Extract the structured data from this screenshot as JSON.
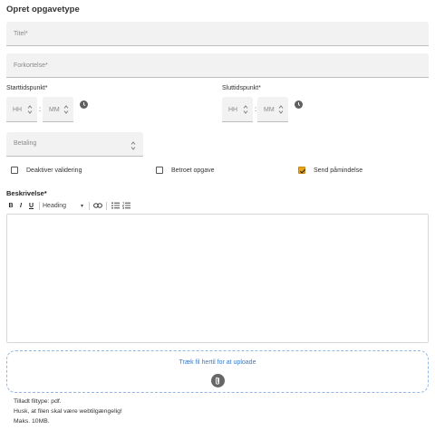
{
  "page": {
    "title": "Opret opgavetype"
  },
  "fields": {
    "title_placeholder": "Titel*",
    "abbr_placeholder": "Forkortelse*",
    "payment_placeholder": "Betaling"
  },
  "start": {
    "label": "Starttidspunkt*",
    "hh": "HH",
    "mm": "MM",
    "sep": ":"
  },
  "end": {
    "label": "Sluttidspunkt*",
    "hh": "HH",
    "mm": "MM",
    "sep": ":"
  },
  "checkboxes": [
    {
      "label": "Deaktiver validering",
      "checked": false
    },
    {
      "label": "Betroet opgave",
      "checked": false
    },
    {
      "label": "Send påmindelse",
      "checked": true
    }
  ],
  "description": {
    "label": "Beskrivelse*",
    "toolbar": {
      "bold": "B",
      "italic": "I",
      "underline": "U",
      "heading": "Heading",
      "heading_arrow": "▾"
    }
  },
  "upload": {
    "drop_text": "Træk fil hertil for at uploade",
    "info": [
      "Tilladt filtype: pdf.",
      "Husk, at filen skal være webtilgængelig!",
      "Maks. 10MB."
    ]
  },
  "colors": {
    "accent_check": "#e8a317",
    "link_blue": "#3a7bc8",
    "field_bg": "#f2f2f2"
  },
  "icons": [
    "clock-icon",
    "spinner-icon",
    "link-icon",
    "bullet-list-icon",
    "numbered-list-icon",
    "paperclip-icon",
    "checkmark-icon"
  ]
}
